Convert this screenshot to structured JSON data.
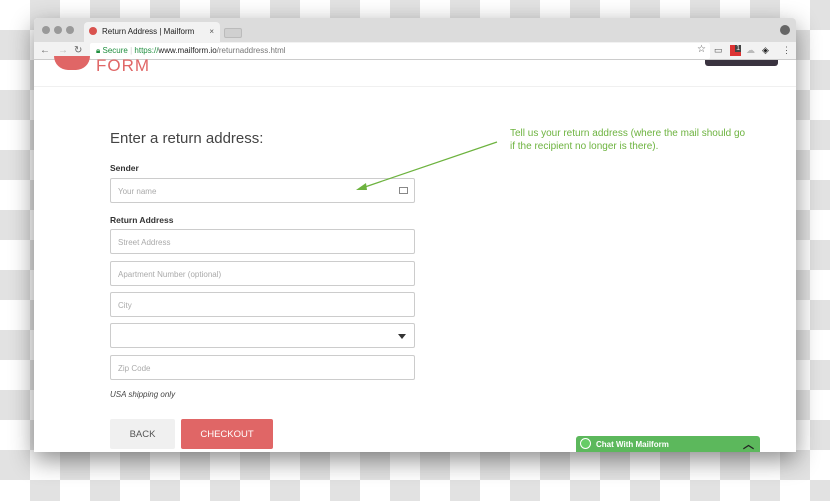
{
  "browser": {
    "tab_title": "Return Address | Mailform",
    "tab_close": "×",
    "secure_label": "Secure",
    "url_scheme": "https://",
    "url_domain": "www.mailform.io",
    "url_path": "/returnaddress.html",
    "extension_badge": "1"
  },
  "page": {
    "logo_text": "FORM",
    "heading": "Enter a return address:",
    "sender_label": "Sender",
    "name_placeholder": "Your name",
    "return_label": "Return Address",
    "street_placeholder": "Street Address",
    "apt_placeholder": "Apartment Number (optional)",
    "city_placeholder": "City",
    "state_value": "",
    "zip_placeholder": "Zip Code",
    "shipping_note": "USA shipping only",
    "back_label": "BACK",
    "checkout_label": "CHECKOUT"
  },
  "annotation": {
    "text": "Tell us your return address (where the mail should go if the recipient no longer is there)."
  },
  "chat": {
    "label": "Chat With Mailform"
  },
  "colors": {
    "accent": "#e06666",
    "annotation": "#6db33f",
    "chat": "#5cb85c"
  }
}
